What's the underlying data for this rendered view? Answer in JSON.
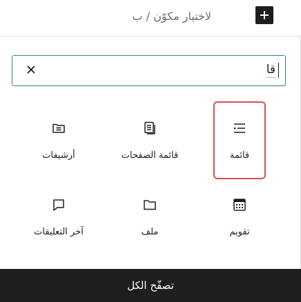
{
  "header": {
    "hint_text": "لاختيار مكوّن / ب",
    "add_icon": "plus-icon"
  },
  "search": {
    "value": "قا",
    "clear_icon": "close-icon"
  },
  "blocks": [
    {
      "label": "قائمة",
      "icon": "list-icon"
    },
    {
      "label": "قائمة الصفحات",
      "icon": "page-list-icon"
    },
    {
      "label": "أرشيفات",
      "icon": "archive-icon"
    },
    {
      "label": "تقويم",
      "icon": "calendar-icon"
    },
    {
      "label": "ملف",
      "icon": "folder-icon"
    },
    {
      "label": "آخر التعليقات",
      "icon": "comment-icon"
    }
  ],
  "footer": {
    "browse_all_label": "تصفّح الكل"
  },
  "colors": {
    "accent": "#2f7d95",
    "highlight": "#d94f4f",
    "dark": "#1e1e1e"
  }
}
